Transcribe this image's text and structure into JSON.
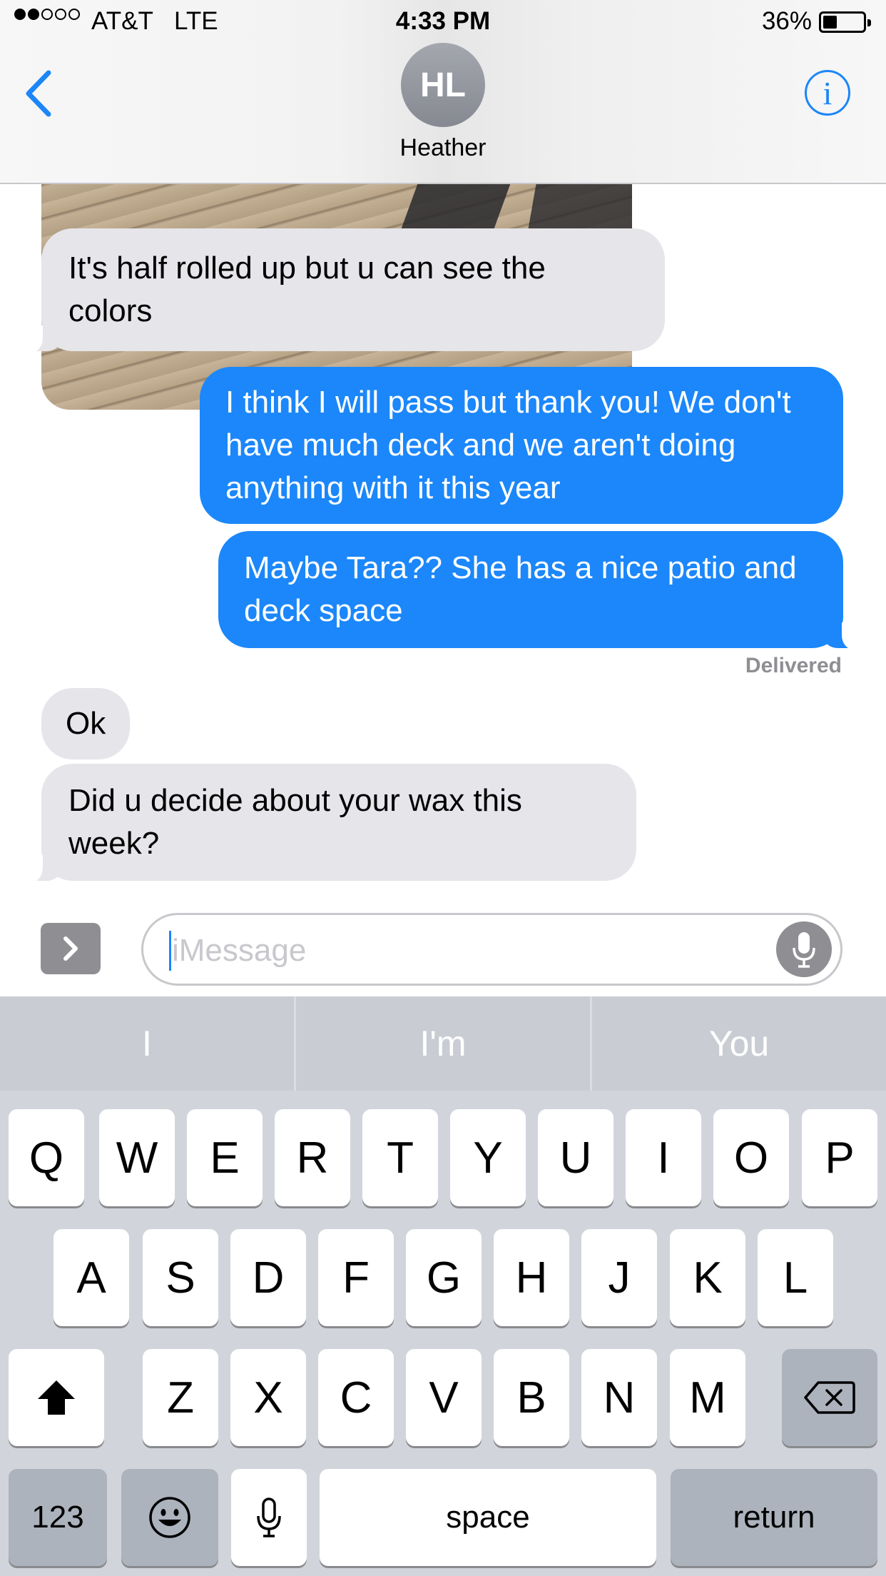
{
  "status_bar": {
    "carrier": "AT&T",
    "network": "LTE",
    "time": "4:33 PM",
    "battery_percent": "36%",
    "signal_bars": 2,
    "battery_level": 0.36
  },
  "header": {
    "avatar_initials": "HL",
    "contact_name": "Heather",
    "info_glyph": "i"
  },
  "messages": [
    {
      "direction": "incoming",
      "text": "It's half rolled up but u can see the colors"
    },
    {
      "direction": "outgoing",
      "text": "I think I will pass but thank you! We don't have much deck and we aren't doing anything with it this year"
    },
    {
      "direction": "outgoing",
      "text": "Maybe Tara?? She has a nice patio and deck space"
    },
    {
      "direction": "incoming",
      "text": "Ok"
    },
    {
      "direction": "incoming",
      "text": "Did u decide about your wax this week?"
    }
  ],
  "delivery_status": "Delivered",
  "compose": {
    "placeholder": "iMessage"
  },
  "keyboard": {
    "predictions": [
      "I",
      "I'm",
      "You"
    ],
    "row1": [
      "Q",
      "W",
      "E",
      "R",
      "T",
      "Y",
      "U",
      "I",
      "O",
      "P"
    ],
    "row2": [
      "A",
      "S",
      "D",
      "F",
      "G",
      "H",
      "J",
      "K",
      "L"
    ],
    "row3": [
      "Z",
      "X",
      "C",
      "V",
      "B",
      "N",
      "M"
    ],
    "numbers_label": "123",
    "space_label": "space",
    "return_label": "return"
  },
  "colors": {
    "accent_blue": "#1b87fa",
    "incoming_bubble": "#e5e5ea",
    "keyboard_bg": "#d1d5db",
    "dark_key": "#acb3bd"
  }
}
